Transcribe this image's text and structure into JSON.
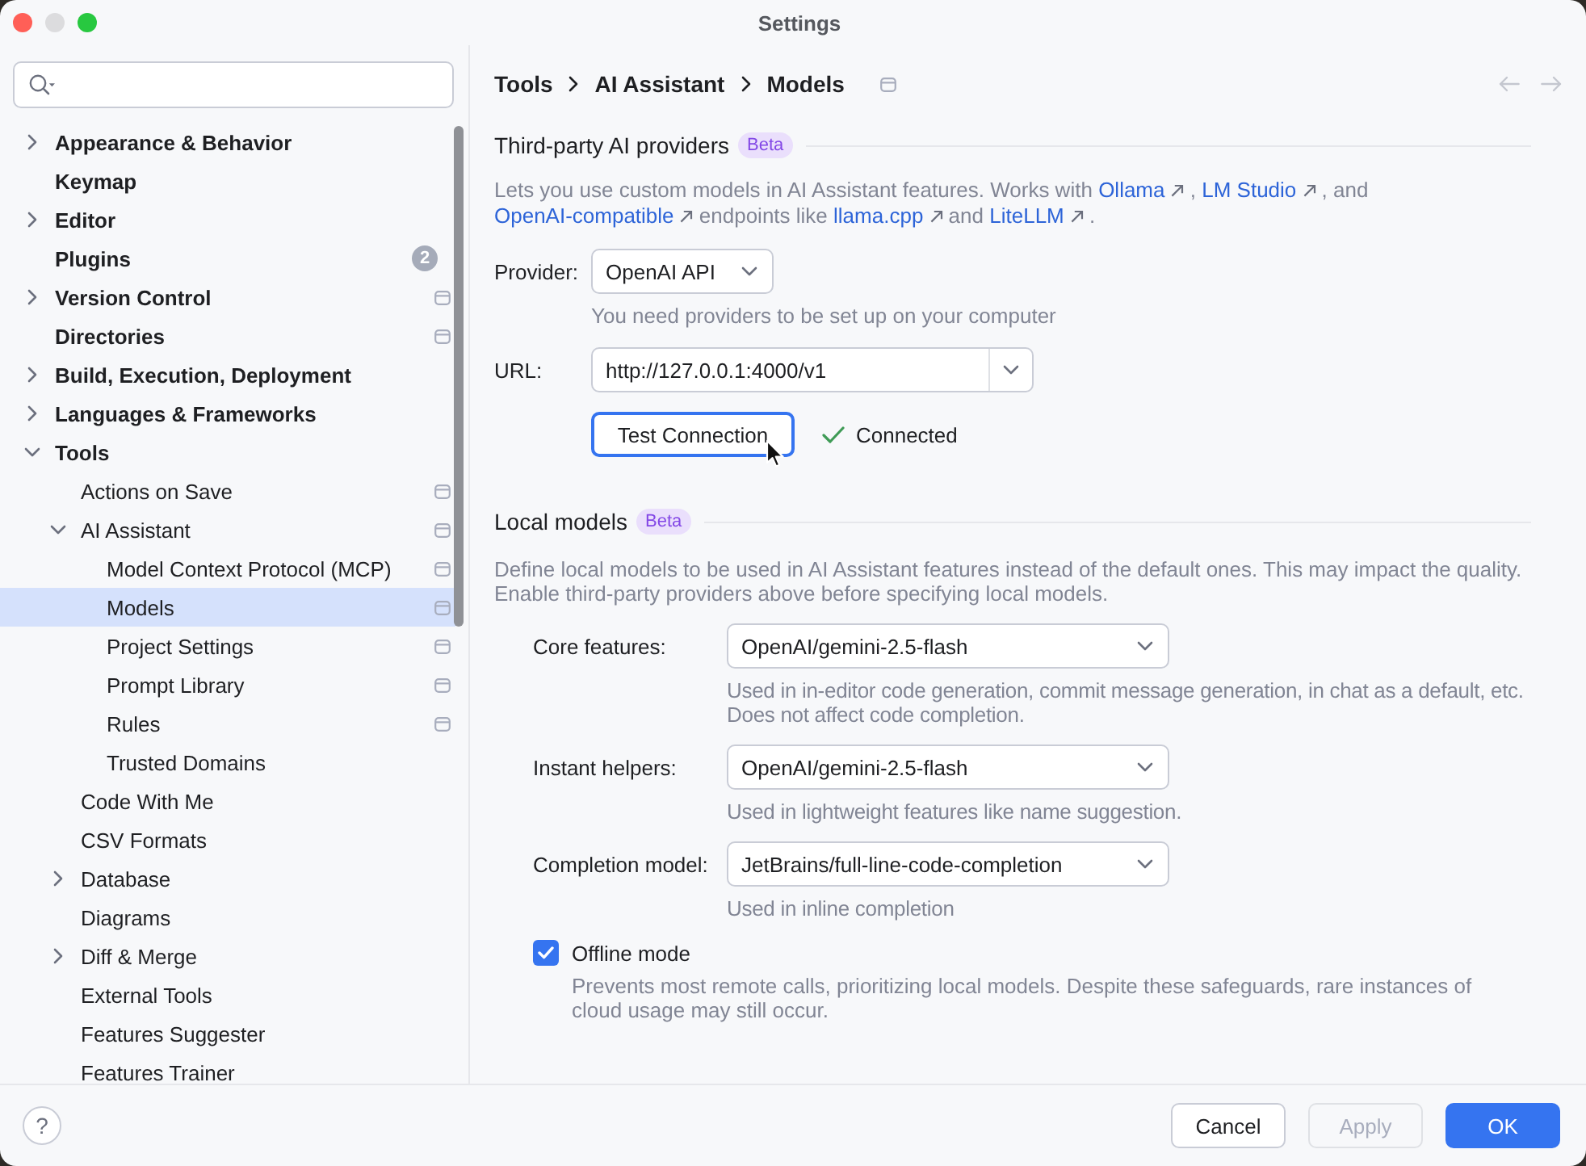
{
  "window": {
    "title": "Settings",
    "buttons": [
      {
        "kind": "close",
        "disabled": false
      },
      {
        "kind": "minimize",
        "disabled": true
      },
      {
        "kind": "zoom",
        "disabled": false
      }
    ]
  },
  "sidebar": {
    "items": [
      {
        "label": "Appearance & Behavior",
        "expanded": false,
        "selected": false,
        "project_level": false
      },
      {
        "label": "Keymap",
        "selected": false,
        "project_level": false
      },
      {
        "label": "Editor",
        "expanded": false,
        "selected": false,
        "project_level": false
      },
      {
        "label": "Plugins",
        "badge": "2",
        "selected": false,
        "project_level": false
      },
      {
        "label": "Version Control",
        "expanded": false,
        "selected": false,
        "project_level": true
      },
      {
        "label": "Directories",
        "selected": false,
        "project_level": true
      },
      {
        "label": "Build, Execution, Deployment",
        "expanded": false,
        "selected": false,
        "project_level": false
      },
      {
        "label": "Languages & Frameworks",
        "expanded": false,
        "selected": false,
        "project_level": false
      },
      {
        "label": "Tools",
        "expanded": true,
        "selected": false,
        "project_level": false,
        "children": [
          {
            "label": "Actions on Save",
            "selected": false,
            "project_level": true
          },
          {
            "label": "AI Assistant",
            "expanded": true,
            "selected": false,
            "project_level": true,
            "children": [
              {
                "label": "Model Context Protocol (MCP)",
                "selected": false,
                "project_level": true
              },
              {
                "label": "Models",
                "selected": true,
                "project_level": true
              },
              {
                "label": "Project Settings",
                "selected": false,
                "project_level": true
              },
              {
                "label": "Prompt Library",
                "selected": false,
                "project_level": true
              },
              {
                "label": "Rules",
                "selected": false,
                "project_level": true
              },
              {
                "label": "Trusted Domains",
                "selected": false,
                "project_level": false
              }
            ]
          },
          {
            "label": "Code With Me",
            "selected": false,
            "project_level": false
          },
          {
            "label": "CSV Formats",
            "selected": false,
            "project_level": false
          },
          {
            "label": "Database",
            "expanded": false,
            "selected": false,
            "project_level": false
          },
          {
            "label": "Diagrams",
            "selected": false,
            "project_level": false
          },
          {
            "label": "Diff & Merge",
            "expanded": false,
            "selected": false,
            "project_level": false
          },
          {
            "label": "External Tools",
            "selected": false,
            "project_level": false
          },
          {
            "label": "Features Suggester",
            "selected": false,
            "project_level": false
          },
          {
            "label": "Features Trainer",
            "selected": false,
            "project_level": false
          }
        ]
      }
    ]
  },
  "breadcrumb": {
    "items": [
      "Tools",
      "AI Assistant",
      "Models"
    ],
    "project_level": true
  },
  "nav_buttons": [
    {
      "kind": "back",
      "disabled": true
    },
    {
      "kind": "forward",
      "disabled": true
    }
  ],
  "third_party": {
    "title": "Third-party AI providers",
    "badge": "Beta",
    "description": [
      {
        "kind": "text",
        "text": "Lets you use custom models in AI Assistant features. Works with"
      },
      {
        "kind": "link",
        "text": "Ollama"
      },
      {
        "kind": "text",
        "text": ","
      },
      {
        "kind": "link",
        "text": "LM Studio"
      },
      {
        "kind": "text",
        "text": ", and"
      },
      {
        "kind": "link",
        "text": "OpenAI-compatible"
      },
      {
        "kind": "text",
        "text": "endpoints like"
      },
      {
        "kind": "link",
        "text": "llama.cpp"
      },
      {
        "kind": "text",
        "text": "and"
      },
      {
        "kind": "link",
        "text": "LiteLLM"
      },
      {
        "kind": "text",
        "text": "."
      }
    ],
    "provider": {
      "label": "Provider:",
      "value": "OpenAI API",
      "hint": "You need providers to be set up on your computer"
    },
    "url": {
      "label": "URL:",
      "value": "http://127.0.0.1:4000/v1"
    },
    "test_button": {
      "label": "Test Connection",
      "focused": true
    },
    "status": {
      "kind": "success",
      "text": "Connected"
    }
  },
  "local_models": {
    "title": "Local models",
    "badge": "Beta",
    "description": "Define local models to be used in AI Assistant features instead of the default ones. This may impact the quality. Enable third-party providers above before specifying local models.",
    "fields": [
      {
        "label": "Core features:",
        "value": "OpenAI/gemini-2.5-flash",
        "hint": "Used in in-editor code generation, commit message generation, in chat as a default, etc. Does not affect code completion."
      },
      {
        "label": "Instant helpers:",
        "value": "OpenAI/gemini-2.5-flash",
        "hint": "Used in lightweight features like name suggestion."
      },
      {
        "label": "Completion model:",
        "value": "JetBrains/full-line-code-completion",
        "hint": "Used in inline completion"
      }
    ],
    "offline_mode": {
      "label": "Offline mode",
      "checked": true,
      "description": "Prevents most remote calls, prioritizing local models. Despite these safeguards, rare instances of cloud usage may still occur."
    }
  },
  "footer": {
    "help_label": "?",
    "buttons": [
      {
        "label": "Cancel",
        "kind": "secondary",
        "disabled": false
      },
      {
        "label": "Apply",
        "kind": "secondary",
        "disabled": true
      },
      {
        "label": "OK",
        "kind": "primary",
        "disabled": false
      }
    ]
  }
}
